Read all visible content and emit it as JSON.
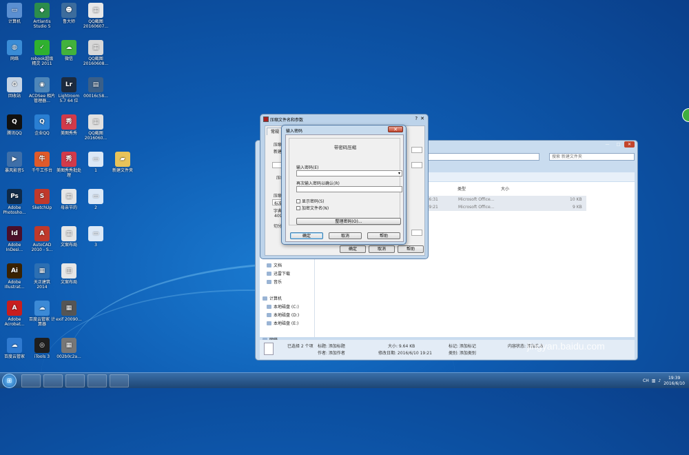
{
  "desktop_icons": [
    {
      "label": "计算机",
      "color": "#5b8fd1",
      "glyph": "▭"
    },
    {
      "label": "Artlantis Studio 5",
      "color": "#2c8d4c",
      "glyph": "◆"
    },
    {
      "label": "鲁大师",
      "color": "#3c6c9d",
      "glyph": "☻"
    },
    {
      "label": "QQ截图 20160607...",
      "color": "#e8e8e8",
      "glyph": "▦"
    },
    {
      "label": "网络",
      "color": "#3a8cd6",
      "glyph": "◍"
    },
    {
      "label": "rebook超级精灵 2011",
      "color": "#2fb12f",
      "glyph": "✓"
    },
    {
      "label": "微信",
      "color": "#42b23c",
      "glyph": "☁"
    },
    {
      "label": "QQ截图 20160608...",
      "color": "#d8d8d8",
      "glyph": "▦"
    },
    {
      "label": "回收站",
      "color": "#c5d3e4",
      "glyph": "♻"
    },
    {
      "label": "ACDSee 相片管理器...",
      "color": "#4e86b9",
      "glyph": "◉"
    },
    {
      "label": "Lightroom 5.7 64 位",
      "color": "#1c2b3f",
      "glyph": "Lr"
    },
    {
      "label": "00016c58...",
      "color": "#3a5f88",
      "glyph": "▤"
    },
    {
      "label": "腾讯QQ",
      "color": "#111111",
      "glyph": "Q"
    },
    {
      "label": "企业QQ",
      "color": "#2a7fd3",
      "glyph": "Q"
    },
    {
      "label": "美图秀秀",
      "color": "#d23a4a",
      "glyph": "秀"
    },
    {
      "label": "QQ截图 2016060...",
      "color": "#e0e0e0",
      "glyph": "▦"
    },
    {
      "label": "暴风影音5",
      "color": "#3f6fa8",
      "glyph": "▶"
    },
    {
      "label": "千牛工作台",
      "color": "#e05a2a",
      "glyph": "牛"
    },
    {
      "label": "美图秀秀批处理",
      "color": "#d23a4a",
      "glyph": "秀"
    },
    {
      "label": "1",
      "color": "#dbe8f6",
      "glyph": "▭"
    },
    {
      "label": "新建文件夹",
      "color": "#e8c35a",
      "glyph": "▰"
    },
    {
      "label": "Adobe Photosho...",
      "color": "#0f2a48",
      "glyph": "Ps"
    },
    {
      "label": "SketchUp",
      "color": "#c0392b",
      "glyph": "S"
    },
    {
      "label": "母亲节的",
      "color": "#e6e6e6",
      "glyph": "▦"
    },
    {
      "label": "2",
      "color": "#dbe8f6",
      "glyph": "▭"
    },
    {
      "label": "Adobe InDesi...",
      "color": "#4a0f2a",
      "glyph": "Id"
    },
    {
      "label": "AutoCAD 2010 - S...",
      "color": "#c0392b",
      "glyph": "A"
    },
    {
      "label": "文案布局",
      "color": "#e6e6e6",
      "glyph": "▦"
    },
    {
      "label": "3",
      "color": "#dbe8f6",
      "glyph": "▭"
    },
    {
      "label": "Adobe Illustrat...",
      "color": "#3a2200",
      "glyph": "Ai"
    },
    {
      "label": "天正建筑 2014",
      "color": "#2c6fb3",
      "glyph": "▦"
    },
    {
      "label": "文案布局",
      "color": "#e6e6e6",
      "glyph": "▥"
    },
    {
      "label": "Adobe Acrobat...",
      "color": "#c81e1e",
      "glyph": "A"
    },
    {
      "label": "百度云管家 计算器",
      "color": "#3c8ad6",
      "glyph": "☁"
    },
    {
      "label": "exif 20090...",
      "color": "#555555",
      "glyph": "▦"
    },
    {
      "label": "百度云管家",
      "color": "#2f7ad0",
      "glyph": "☁"
    },
    {
      "label": "iTools 3",
      "color": "#1e1e1e",
      "glyph": "◎"
    },
    {
      "label": "002b0c2a...",
      "color": "#777777",
      "glyph": "▦"
    }
  ],
  "explorer": {
    "search_placeholder": "搜索 新建文件夹",
    "columns": {
      "type": "类型",
      "size": "大小"
    },
    "files": [
      {
        "date": "/10 16:31",
        "type": "Microsoft Office...",
        "size": "10 KB"
      },
      {
        "date": "/10 19:21",
        "type": "Microsoft Office...",
        "size": "9 KB"
      }
    ],
    "nav": [
      {
        "label": "文档"
      },
      {
        "label": "迅雷下载"
      },
      {
        "label": "音乐"
      },
      {
        "label": "计算机"
      },
      {
        "label": "本地磁盘 (C:)"
      },
      {
        "label": "本地磁盘 (D:)"
      },
      {
        "label": "本地磁盘 (E:)"
      },
      {
        "label": "网络"
      }
    ],
    "details": {
      "selected": "已选择 2 个项",
      "title": "标题: 添加标题",
      "author": "作者: 添加作者",
      "size": "大小: 9.64 KB",
      "modified": "修改日期: 2016/6/10 19:21",
      "tags": "标记: 添加标记",
      "category": "类别: 添加类别",
      "status": "内容状态: 添加文本"
    }
  },
  "archive_dialog": {
    "title": "压缩文件名和参数",
    "tab_general": "常规",
    "ghost_labels": [
      "压缩",
      "新建",
      "压缩",
      "压缩",
      "标准",
      "字典",
      "4096",
      "切分"
    ],
    "ok": "确定",
    "cancel": "取消",
    "help": "帮助"
  },
  "password_dialog": {
    "title": "输入密码",
    "heading": "带密码压缩",
    "password_label": "输入密码(E)",
    "confirm_label": "再次输入密码以确认(R)",
    "show_password": "显示密码(S)",
    "encrypt_names": "加密文件名(N)",
    "organize_button": "整理密码(O)...",
    "ok": "确定",
    "cancel": "取消",
    "help": "帮助"
  },
  "taskbar": {
    "time": "19:39",
    "date": "2016/6/10",
    "lang": "CH"
  },
  "watermark": {
    "logo": "Baidu经验",
    "url": "jingyan.baidu.com"
  }
}
